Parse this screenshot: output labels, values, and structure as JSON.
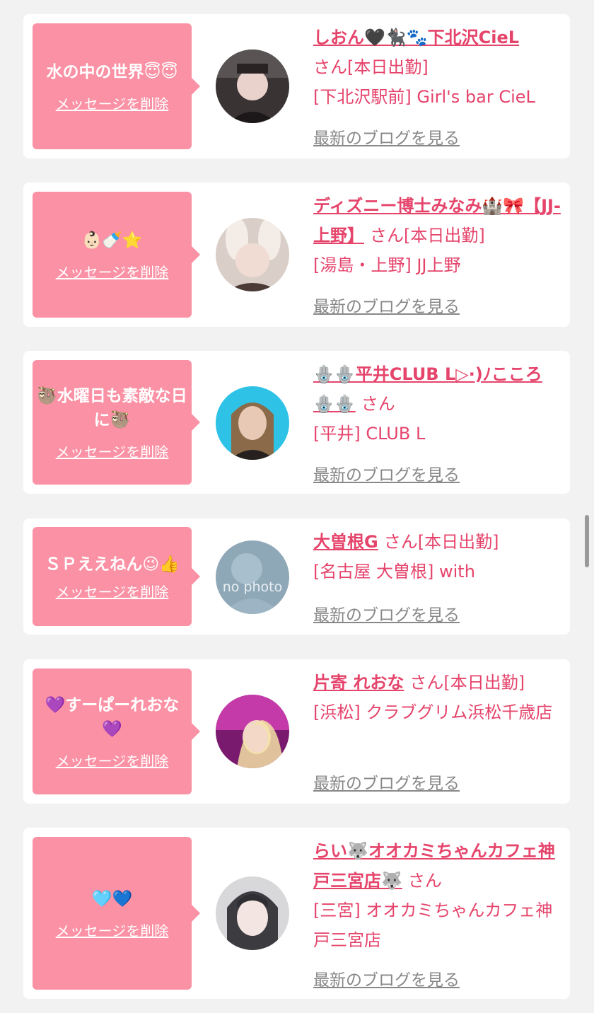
{
  "delete_label": "メッセージを削除",
  "blog_label": "最新のブログを見る",
  "suffix_label": "さん",
  "colors": {
    "accent": "#e5446b",
    "bubble": "#fb91a4",
    "link_gray": "#888888"
  },
  "entries": [
    {
      "message": "水の中の世界😇😇",
      "name": "しおん🖤🐈‍⬛🐾下北沢CieL",
      "suffix": "さん[本日出勤]",
      "shop": "[下北沢駅前] Girl's bar CieL",
      "avatar_icon": "profile-photo-icon"
    },
    {
      "message": "👶🏻🍼⭐️",
      "name": "ディズニー博士みなみ🏰🎀【JJ-上野】",
      "suffix": "さん[本日出勤]",
      "shop": "[湯島・上野] JJ上野",
      "avatar_icon": "profile-photo-icon"
    },
    {
      "message": "🦥水曜日も素敵な日に🦥",
      "name": "🪬🪬平井CLUB L▷·)ﾉこころ🪬🪬",
      "suffix": "さん",
      "shop": "[平井] CLUB L",
      "avatar_icon": "profile-photo-icon"
    },
    {
      "message": "ＳＰええねん😉👍",
      "name": "大曽根G",
      "suffix": "さん[本日出勤]",
      "shop": "[名古屋 大曽根] with",
      "avatar_icon": "no-photo-icon",
      "avatar_text": "no photo"
    },
    {
      "message": "💜すーぱーれおな💜",
      "name": "片寄 れおな",
      "suffix": "さん[本日出勤]",
      "shop": "[浜松] クラブグリム浜松千歳店",
      "avatar_icon": "profile-photo-icon"
    },
    {
      "message": "🩵💙",
      "name": "らい🐺オオカミちゃんカフェ神戸三宮店🐺",
      "suffix": "さん",
      "shop": "[三宮] オオカミちゃんカフェ神戸三宮店",
      "avatar_icon": "profile-photo-icon"
    }
  ]
}
